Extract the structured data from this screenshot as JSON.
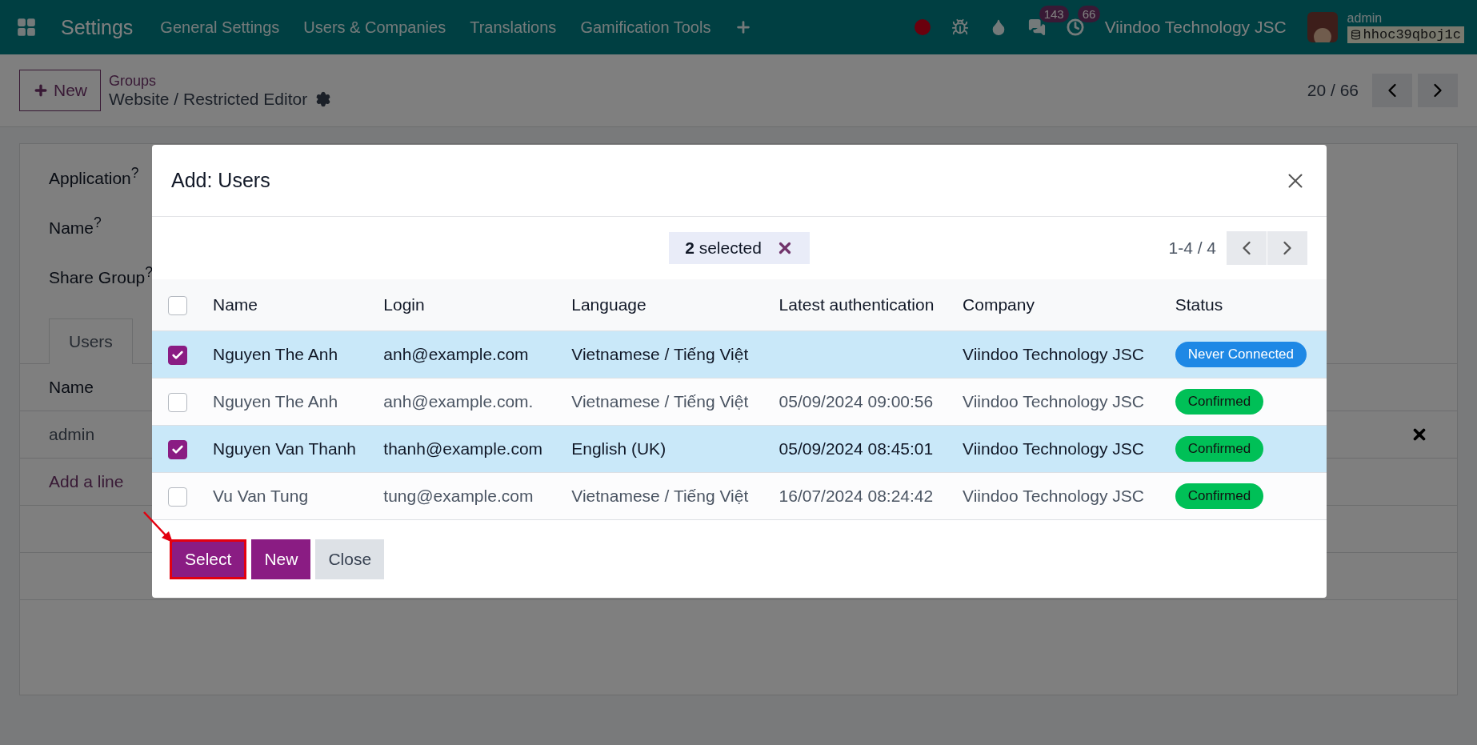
{
  "navbar": {
    "app_title": "Settings",
    "menu": [
      "General Settings",
      "Users & Companies",
      "Translations",
      "Gamification Tools"
    ],
    "chat_count": "143",
    "activity_count": "66",
    "company": "Viindoo Technology JSC",
    "user": "admin",
    "database": "hhoc39qboj1c"
  },
  "control_panel": {
    "new_button": "New",
    "breadcrumb": "Groups",
    "record_title": "Website / Restricted Editor",
    "pager": "20 / 66"
  },
  "form": {
    "fields": [
      "Application$^{?}$",
      "Name$^{?}$",
      "Share Group$^{?}$"
    ],
    "tabs": [
      {
        "label": "Users",
        "selected": true
      }
    ],
    "list": {
      "column": "Name",
      "rows": [
        "admin"
      ],
      "add_line": "Add a line"
    }
  },
  "dialog": {
    "title": "Add: Users",
    "selection": "**2** selected",
    "pager": "1-4 / 4",
    "all_checked": false,
    "columns": [
      "Name",
      "Login",
      "Language",
      "Latest authentication",
      "Company",
      "Status"
    ],
    "rows": [
      {
        "selected": true,
        "name": "Nguyen The Anh",
        "login": "anh@example.com",
        "language": "Vietnamese / Tiếng Việt",
        "company": "Viindoo Technology JSC",
        "status": {
          "label": "Never Connected",
          "color": "#1e88e5"
        }
      },
      {
        "selected": false,
        "name": "Nguyen The Anh",
        "login": "anh@example.com.",
        "language": "Vietnamese / Tiếng Việt",
        "latest_authentication": "05/09/2024 09:00:56",
        "company": "Viindoo Technology JSC",
        "status": {
          "label": "Confirmed",
          "color": "#00c057"
        }
      },
      {
        "selected": true,
        "name": "Nguyen Van Thanh",
        "login": "thanh@example.com",
        "language": "English (UK)",
        "latest_authentication": "05/09/2024 08:45:01",
        "company": "Viindoo Technology JSC",
        "status": {
          "label": "Confirmed",
          "color": "#00c057"
        }
      },
      {
        "selected": false,
        "name": "Vu Van Tung",
        "login": "tung@example.com",
        "language": "Vietnamese / Tiếng Việt",
        "latest_authentication": "16/07/2024 08:24:42",
        "company": "Viindoo Technology JSC",
        "status": {
          "label": "Confirmed",
          "color": "#00c057"
        }
      }
    ],
    "buttons": [
      {
        "label": "Select",
        "kind": "primary",
        "highlighted": true
      },
      {
        "label": "New",
        "kind": "primary",
        "highlighted": false
      },
      {
        "label": "Close",
        "kind": "secondary",
        "highlighted": false
      }
    ]
  }
}
